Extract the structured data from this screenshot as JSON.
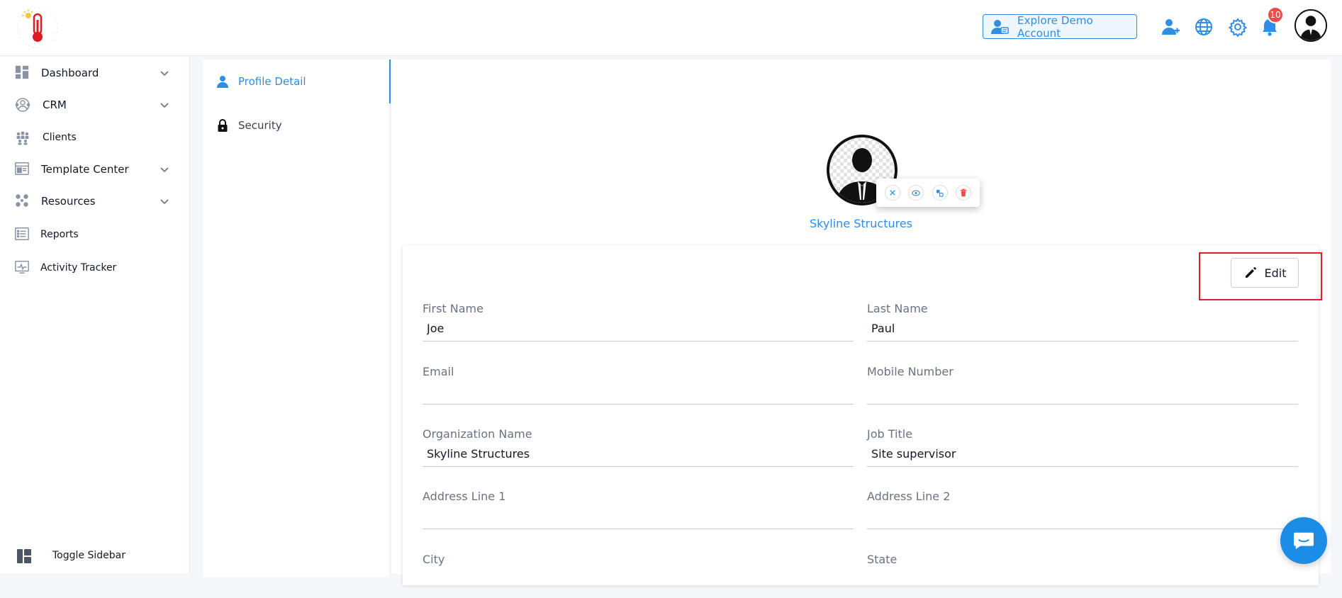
{
  "topbar": {
    "demo_button_label": "Explore Demo Account",
    "notification_count": "10",
    "icons": [
      "add-user-icon",
      "globe-icon",
      "gear-icon",
      "bell-icon",
      "avatar"
    ]
  },
  "sidebar": {
    "items": [
      {
        "label": "Dashboard",
        "icon": "dashboard-icon",
        "has_submenu": true
      },
      {
        "label": "CRM",
        "icon": "crm-icon",
        "has_submenu": true
      },
      {
        "label": "Clients",
        "icon": "clients-icon",
        "has_submenu": false
      },
      {
        "label": "Template Center",
        "icon": "template-icon",
        "has_submenu": true
      },
      {
        "label": "Resources",
        "icon": "resources-icon",
        "has_submenu": true
      },
      {
        "label": "Reports",
        "icon": "reports-icon",
        "has_submenu": false
      },
      {
        "label": "Activity Tracker",
        "icon": "activity-icon",
        "has_submenu": false
      }
    ],
    "toggle_label": "Toggle Sidebar"
  },
  "settings_nav": {
    "tabs": [
      {
        "label": "Profile Detail",
        "icon": "user-icon",
        "active": true
      },
      {
        "label": "Security",
        "icon": "lock-icon",
        "active": false
      }
    ]
  },
  "profile": {
    "organization_display": "Skyline Structures",
    "edit_label": "Edit",
    "fields": {
      "first_name": {
        "label": "First Name",
        "value": "Joe"
      },
      "last_name": {
        "label": "Last Name",
        "value": "Paul"
      },
      "email": {
        "label": "Email",
        "value": ""
      },
      "mobile": {
        "label": "Mobile Number",
        "value": ""
      },
      "organization": {
        "label": "Organization Name",
        "value": "Skyline Structures"
      },
      "job_title": {
        "label": "Job Title",
        "value": "Site supervisor"
      },
      "address1": {
        "label": "Address Line 1",
        "value": ""
      },
      "address2": {
        "label": "Address Line 2",
        "value": ""
      },
      "city": {
        "label": "City",
        "value": ""
      },
      "state": {
        "label": "State",
        "value": ""
      }
    }
  },
  "colors": {
    "accent": "#2f8de4",
    "badge": "#f04b4b",
    "highlight": "#e11d2a",
    "chat": "#1b8de6"
  }
}
